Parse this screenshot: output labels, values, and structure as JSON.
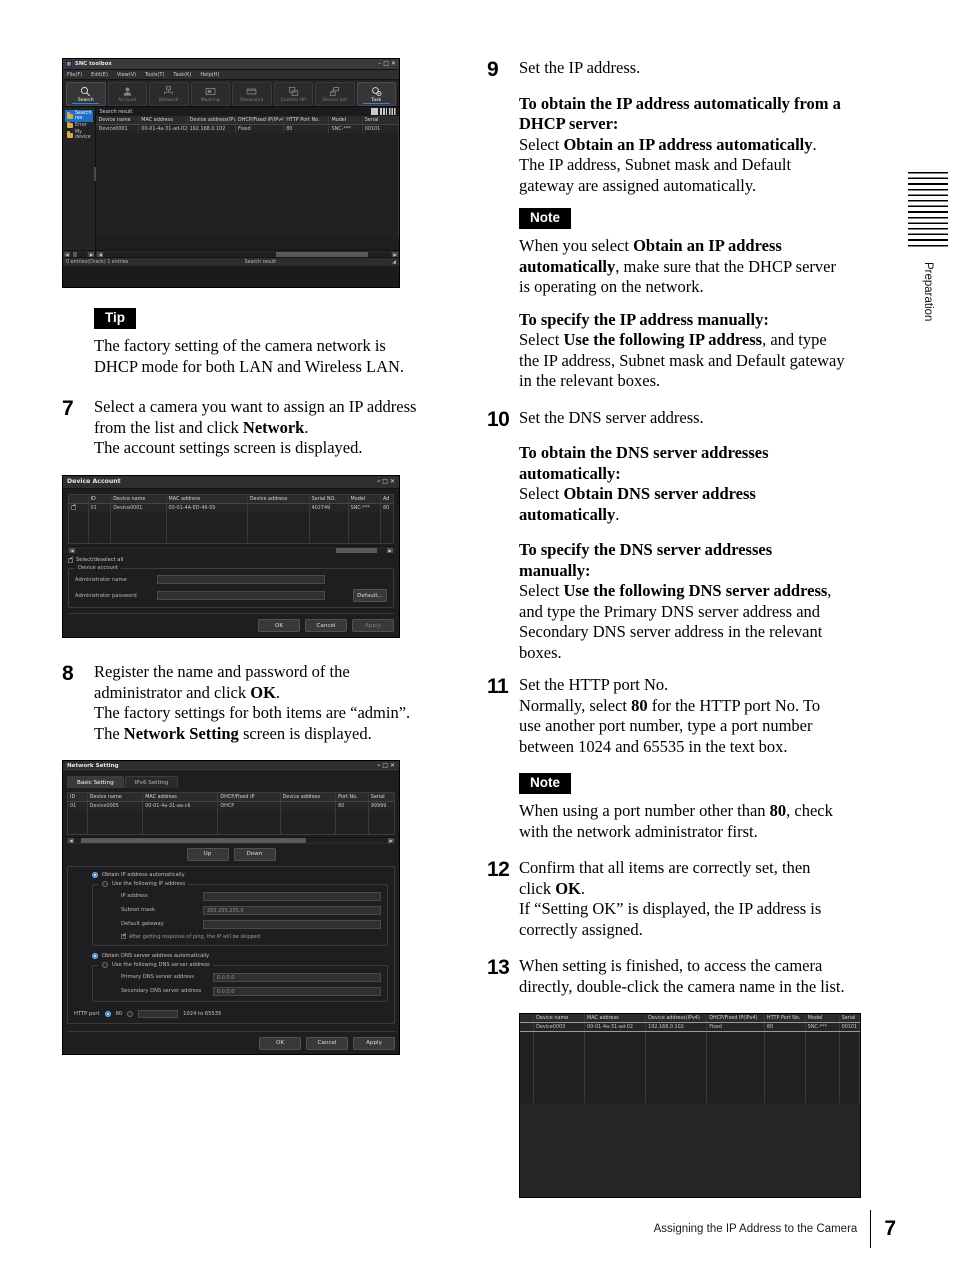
{
  "page": {
    "number": "7",
    "footer_text": "Assigning the IP Address to the Camera",
    "side_tab_label": "Preparation"
  },
  "left_column": {
    "tip": {
      "badge": "Tip",
      "text": "The factory setting of the camera network is DHCP mode for both LAN and Wireless LAN."
    },
    "step7": {
      "number": "7",
      "line1_a": "Select a camera you want to assign an IP address from the list and click ",
      "line1_b": "Network",
      "line1_c": ".",
      "line2": "The account settings screen is displayed."
    },
    "step8": {
      "number": "8",
      "line1_a": "Register the name and password of the administrator and click ",
      "line1_b": "OK",
      "line1_c": ".",
      "line2": "The factory settings for both items are “admin”.",
      "line3_a": "The ",
      "line3_b": "Network Setting",
      "line3_c": " screen is displayed."
    }
  },
  "right_column": {
    "step9": {
      "number": "9",
      "intro": "Set the IP address.",
      "auto_heading": "To obtain the IP address automatically from a DHCP server:",
      "auto_line_a": "Select ",
      "auto_line_b": "Obtain an IP address automatically",
      "auto_line_c": ".",
      "auto_line2": "The IP address, Subnet mask and Default gateway are assigned automatically.",
      "note": {
        "badge": "Note",
        "text_a": "When you select ",
        "text_b": "Obtain an IP address automatically",
        "text_c": ", make sure that the DHCP server is operating on the network."
      },
      "manual_heading": "To specify the IP address manually:",
      "manual_line_a": "Select ",
      "manual_line_b": "Use the following IP address",
      "manual_line_c": ", and type the IP address, Subnet mask and Default gateway in the relevant boxes."
    },
    "step10": {
      "number": "10",
      "intro": "Set the DNS server address.",
      "auto_heading": "To obtain the DNS server addresses automatically:",
      "auto_line_a": "Select ",
      "auto_line_b": "Obtain DNS server address automatically",
      "auto_line_c": ".",
      "manual_heading": "To specify the DNS server addresses manually:",
      "manual_line_a": "Select ",
      "manual_line_b": "Use the following DNS server address",
      "manual_line_c": ", and type the Primary DNS server address and Secondary DNS server address in the relevant boxes."
    },
    "step11": {
      "number": "11",
      "intro": "Set the HTTP port No.",
      "line_a": "Normally, select ",
      "line_b": "80",
      "line_c": " for the HTTP port No. To use another port number, type a port number between 1024 and 65535 in the text box.",
      "note": {
        "badge": "Note",
        "text_a": "When using a port number other than ",
        "text_b": "80",
        "text_c": ", check with the network administrator first."
      }
    },
    "step12": {
      "number": "12",
      "line1_a": "Confirm that all items are correctly set, then click ",
      "line1_b": "OK",
      "line1_c": ".",
      "line2": "If “Setting OK” is displayed, the IP address is correctly assigned."
    },
    "step13": {
      "number": "13",
      "text": "When setting is finished, to access the camera directly, double-click the camera name in the list."
    }
  },
  "screenshot_toolbox": {
    "title": "SNC toolbox",
    "window_buttons": [
      "minimize",
      "maximize",
      "close"
    ],
    "menus": [
      "File(F)",
      "Edit(E)",
      "View(V)",
      "Tools(T)",
      "Task(K)",
      "Help(H)"
    ],
    "toolbar": [
      {
        "label": "Search",
        "icon": "magnifier-icon",
        "active": true
      },
      {
        "label": "Account",
        "icon": "person-icon",
        "active": false
      },
      {
        "label": "Network",
        "icon": "network-icon",
        "active": false
      },
      {
        "label": "Masking",
        "icon": "mask-icon",
        "active": false
      },
      {
        "label": "Panorama",
        "icon": "panorama-icon",
        "active": false
      },
      {
        "label": "Custom HP",
        "icon": "customhp-icon",
        "active": false
      },
      {
        "label": "Device Set",
        "icon": "deviceset-icon",
        "active": false
      },
      {
        "label": "Task",
        "icon": "task-gear-icon",
        "active": false
      }
    ],
    "tree": [
      {
        "label": "Search res",
        "selected": true
      },
      {
        "label": "Error",
        "selected": false
      },
      {
        "label": "My device",
        "selected": false
      }
    ],
    "list_label": "Search result",
    "columns": [
      "",
      "Device name",
      "MAC address",
      "Device address(IPv4)",
      "DHCP/Fixed IP(IPv4)",
      "HTTP Port No.",
      "Model",
      "Serial"
    ],
    "sort_column": "Device name",
    "rows": [
      [
        "",
        "Device0001",
        "00-01-4a-31-ad-02",
        "192.168.0.102",
        "Fixed",
        "80",
        "SNC-***",
        "00101"
      ]
    ],
    "empty_rows": 13,
    "status_left": "0 entries(Check) 1 entries",
    "status_center": "Search result"
  },
  "screenshot_device_account": {
    "title": "Device Account",
    "columns": [
      "",
      "ID",
      "Device name",
      "MAC address",
      "Device address",
      "Serial NO.",
      "Model",
      "Ad"
    ],
    "rows": [
      [
        "checked",
        "01",
        "Device0001",
        "00-01-4A-ED-46-59",
        "",
        "402749",
        "SNC-***",
        "80"
      ]
    ],
    "empty_rows": 4,
    "select_all_label": "Select/deselect all",
    "select_all_checked": true,
    "group_label": "Device account",
    "fields": [
      {
        "label": "Administrator name",
        "value": ""
      },
      {
        "label": "Administrator password",
        "value": ""
      }
    ],
    "default_button": "Default...",
    "buttons": [
      "OK",
      "Cancel",
      "Apply"
    ]
  },
  "screenshot_network_setting": {
    "title": "Network Setting",
    "tabs": [
      {
        "label": "Basic Setting",
        "active": true
      },
      {
        "label": "IPv6 Setting",
        "active": false
      }
    ],
    "columns": [
      "ID",
      "Device name",
      "MAC address",
      "DHCP/Fixed IP",
      "Device address",
      "Port No.",
      "Serial"
    ],
    "rows": [
      [
        "01",
        "Device0005",
        "00-01-4a-31-aa-c6",
        "DHCP",
        "",
        "80",
        "99999"
      ]
    ],
    "empty_rows": 3,
    "updown_buttons": [
      "Up",
      "Down"
    ],
    "ip_auto_label": "Obtain IP address automatically",
    "ip_auto_selected": true,
    "ip_manual_label": "Use the following IP address",
    "ip_manual_selected": false,
    "ip_fields": [
      {
        "label": "IP address",
        "value": ""
      },
      {
        "label": "Subnet mask",
        "value": "255.255.255.0"
      },
      {
        "label": "Default gateway",
        "value": ""
      }
    ],
    "ping_checkbox_label": "After getting response of ping, the IP will be skipped",
    "ping_checked": true,
    "dns_auto_label": "Obtain DNS server address automatically",
    "dns_auto_selected": true,
    "dns_manual_label": "Use the following DNS server address",
    "dns_manual_selected": false,
    "dns_fields": [
      {
        "label": "Primary DNS server address",
        "value": "0.0.0.0"
      },
      {
        "label": "Secondary DNS server address",
        "value": "0.0.0.0"
      }
    ],
    "http_port_label": "HTTP port",
    "http_port_default": "80",
    "http_port_default_selected": true,
    "http_port_custom_value": "",
    "http_port_range": "1024 to 65535",
    "buttons": [
      "OK",
      "Cancel",
      "Apply"
    ]
  },
  "screenshot_result_list": {
    "columns": [
      "",
      "Device name",
      "MAC address",
      "Device address(IPv4)",
      "DHCP/Fixed IP(IPv4)",
      "HTTP Port No.",
      "Model",
      "Serial"
    ],
    "sort_column": "Device name",
    "rows": [
      [
        "",
        "Device0003",
        "00-01-4a-31-ad-02",
        "192.168.0.102",
        "Fixed",
        "80",
        "SNC-***",
        "00101"
      ]
    ],
    "empty_rows": 9
  }
}
